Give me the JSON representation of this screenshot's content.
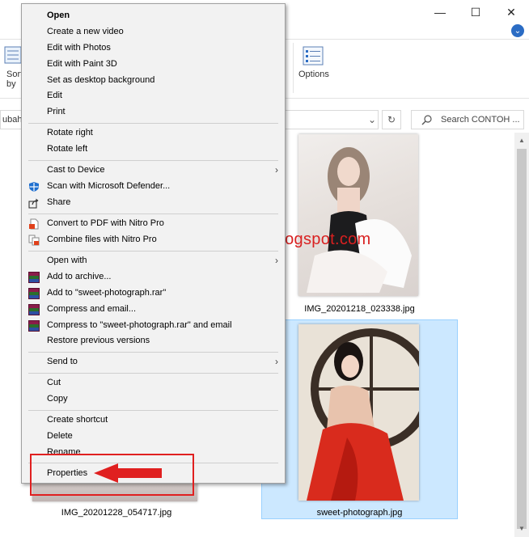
{
  "window": {
    "minimize_glyph": "—",
    "maximize_glyph": "☐",
    "close_glyph": "✕",
    "ribbon_expand_glyph": "⌄"
  },
  "ribbon": {
    "sort_label": "Sort",
    "sort_label2": "by",
    "options_label": "Options"
  },
  "address": {
    "path_fragment": "ubah",
    "search_placeholder": "Search CONTOH ..."
  },
  "files": [
    {
      "name": "IMG_20201218_023338.jpg",
      "selected": false
    },
    {
      "name": "sweet-photograph.jpg",
      "selected": true
    },
    {
      "name": "IMG_20201228_054717.jpg",
      "selected": false
    }
  ],
  "watermark": "sasorishared.blogspot.com",
  "context_menu": {
    "items": [
      {
        "label": "Open"
      },
      {
        "label": "Create a new video"
      },
      {
        "label": "Edit with Photos"
      },
      {
        "label": "Edit with Paint 3D"
      },
      {
        "label": "Set as desktop background"
      },
      {
        "label": "Edit"
      },
      {
        "label": "Print"
      },
      {
        "label": "Rotate right"
      },
      {
        "label": "Rotate left"
      },
      {
        "label": "Cast to Device"
      },
      {
        "label": "Scan with Microsoft Defender..."
      },
      {
        "label": "Share"
      },
      {
        "label": "Convert to PDF with Nitro Pro"
      },
      {
        "label": "Combine files with Nitro Pro"
      },
      {
        "label": "Open with"
      },
      {
        "label": "Add to archive..."
      },
      {
        "label": "Add to \"sweet-photograph.rar\""
      },
      {
        "label": "Compress and email..."
      },
      {
        "label": "Compress to \"sweet-photograph.rar\" and email"
      },
      {
        "label": "Restore previous versions"
      },
      {
        "label": "Send to"
      },
      {
        "label": "Cut"
      },
      {
        "label": "Copy"
      },
      {
        "label": "Create shortcut"
      },
      {
        "label": "Delete"
      },
      {
        "label": "Rename"
      },
      {
        "label": "Properties"
      }
    ],
    "submenu_glyph": "›"
  },
  "colors": {
    "highlight_red": "#e02020",
    "selection_blue": "#cce8ff",
    "menu_bg": "#f2f2f2"
  }
}
